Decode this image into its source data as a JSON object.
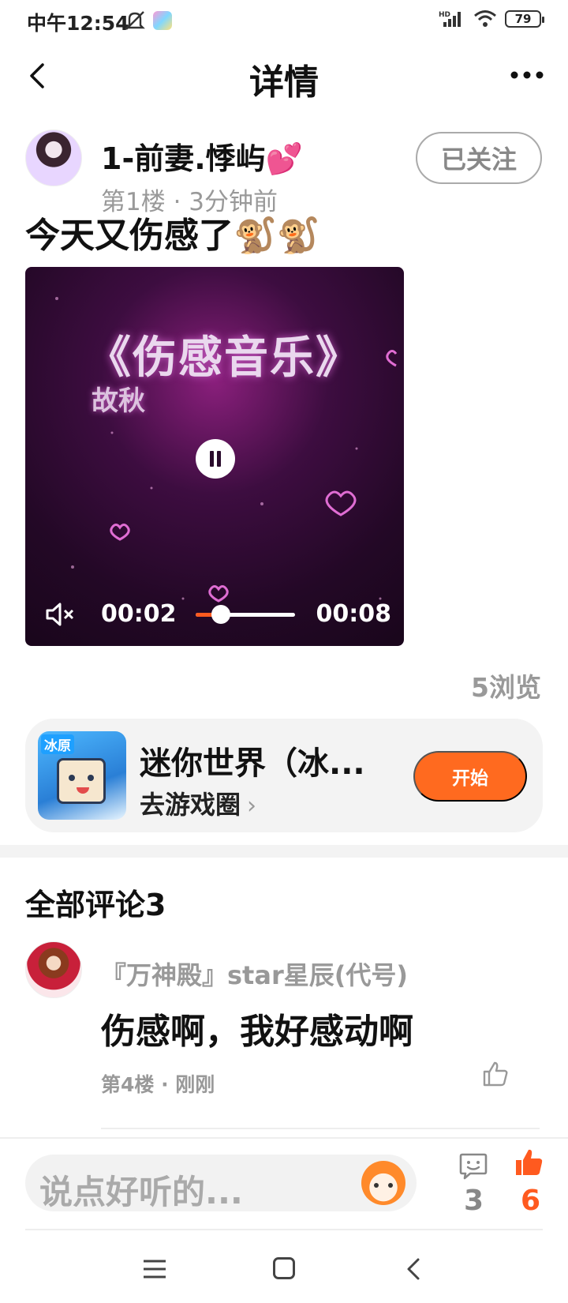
{
  "status_bar": {
    "time": "中午12:54",
    "battery": "79",
    "network": "HD"
  },
  "nav": {
    "title": "详情"
  },
  "post": {
    "author": "1-前妻.悸屿💕",
    "meta": "第1楼 · 3分钟前",
    "follow_label": "已关注",
    "text": "今天又伤感了🐒🐒",
    "views": "5浏览"
  },
  "video": {
    "title": "《伤感音乐》",
    "subtitle": "故秋",
    "current_time": "00:02",
    "total_time": "00:08",
    "progress": 0.25
  },
  "game": {
    "name": "迷你世界（冰...",
    "link_label": "去游戏圈",
    "start_label": "开始",
    "icon_tag": "冰原"
  },
  "comments": {
    "title": "全部评论3",
    "items": [
      {
        "user": "『万神殿』star星辰(代号)",
        "text": "伤感啊，我好感动啊",
        "meta": "第4楼 · 刚刚"
      }
    ]
  },
  "input_bar": {
    "placeholder": "说点好听的...",
    "comment_count": "3",
    "like_count": "6"
  },
  "colors": {
    "accent": "#ff6a1f",
    "muted": "#999999",
    "card_bg": "#f3f3f3"
  }
}
